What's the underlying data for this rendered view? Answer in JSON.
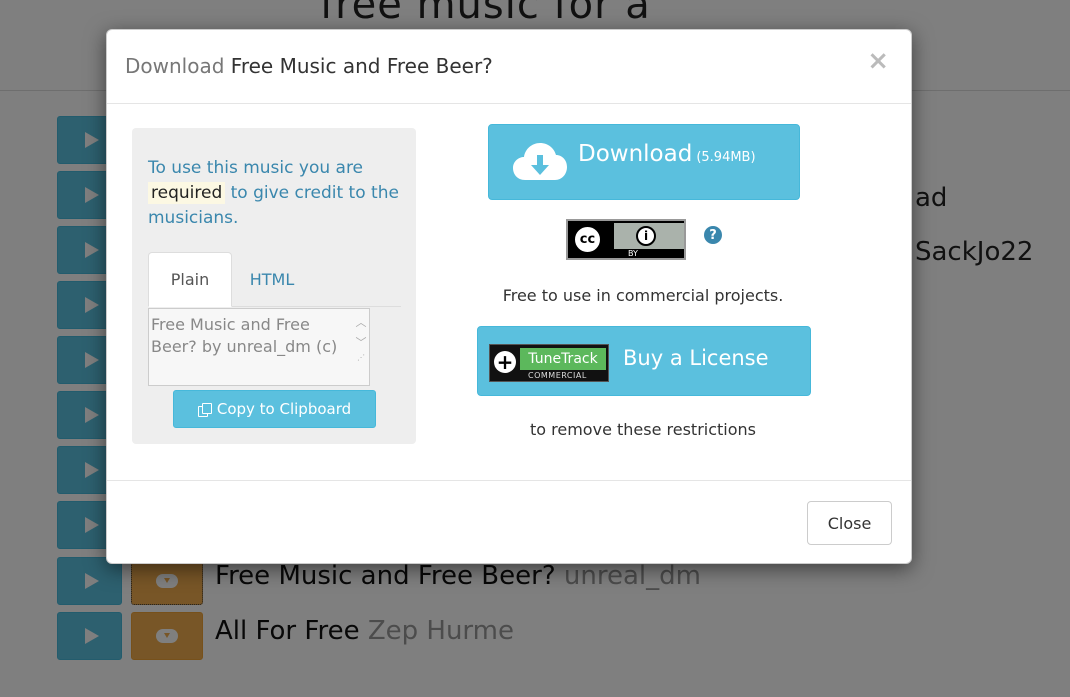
{
  "background": {
    "heading": "free music for a ",
    "right_fragments": [
      "ad",
      "SackJo22"
    ],
    "rows": [
      {
        "title": "",
        "artist": ""
      },
      {
        "title": "",
        "artist": ""
      },
      {
        "title": "",
        "artist": ""
      },
      {
        "title": "",
        "artist": ""
      },
      {
        "title": "",
        "artist": ""
      },
      {
        "title": "",
        "artist": ""
      },
      {
        "title": "",
        "artist": ""
      },
      {
        "title": "",
        "artist": ""
      },
      {
        "title": "Free Music and Free Beer?",
        "artist": "unreal_dm"
      },
      {
        "title": "All For Free",
        "artist": "Zep Hurme"
      }
    ]
  },
  "modal": {
    "title_prefix": "Download",
    "title_main": "Free Music and Free Beer?",
    "close_symbol": "×",
    "credit": {
      "part1": "To use this music you are",
      "highlight": "required",
      "part2": "to give credit to the musicians."
    },
    "tabs": [
      {
        "label": "Plain",
        "active": true
      },
      {
        "label": "HTML",
        "active": false
      }
    ],
    "attribution_text": "Free Music and Free Beer? by unreal_dm (c)",
    "copy_button": "Copy to Clipboard",
    "download": {
      "label": "Download",
      "size": "(5.94MB)"
    },
    "license_badge": {
      "cc": "cc",
      "by_icon": "i",
      "by": "BY"
    },
    "help_symbol": "?",
    "commercial_note": "Free to use in commercial projects.",
    "tunetrack": {
      "plus": "+",
      "name": "TuneTrack",
      "sub": "COMMERCIAL"
    },
    "buy_license": "Buy a License",
    "restrictions_note": "to remove these restrictions",
    "close_button": "Close"
  },
  "colors": {
    "info_blue": "#5bc0de",
    "warning_orange": "#f0ad4e",
    "link_blue": "#3a87ad"
  }
}
